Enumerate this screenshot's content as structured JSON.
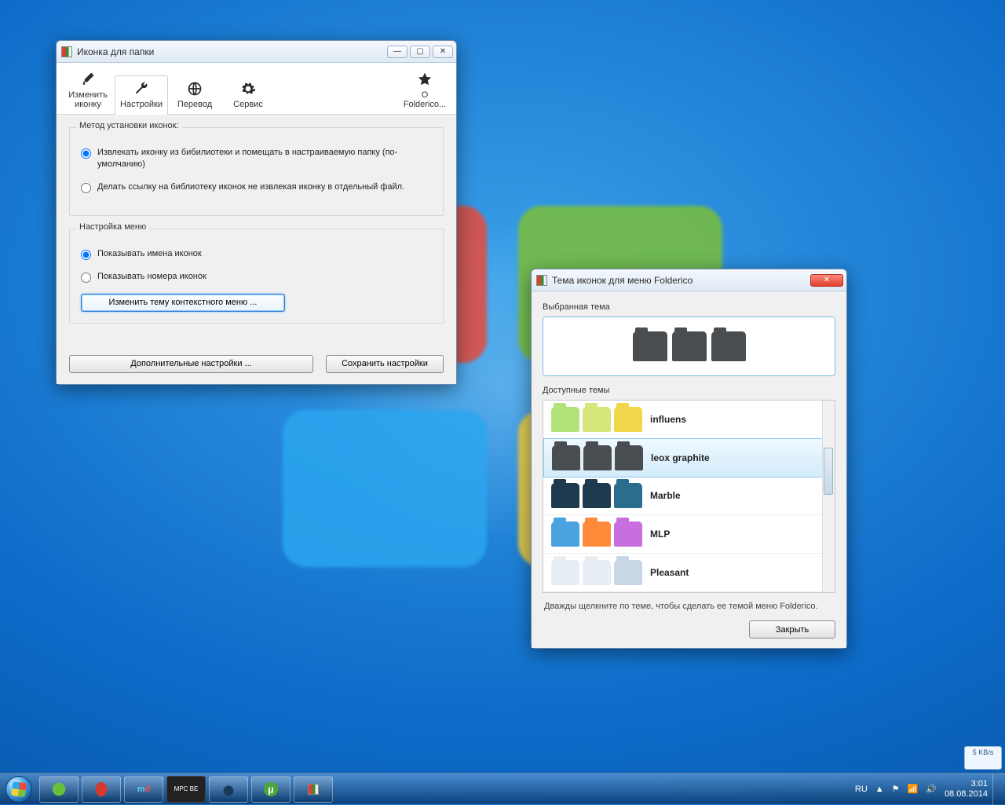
{
  "win1": {
    "title": "Иконка для папки",
    "tabs": {
      "change_icon": "Изменить иконку",
      "settings": "Настройки",
      "translate": "Перевод",
      "service": "Сервис",
      "about": "О Folderico..."
    },
    "group1": {
      "legend": "Метод установки иконок:",
      "opt1": "Извлекать иконку из бибилиотеки и помещать в настраиваемую папку (по-умолчанию)",
      "opt2": "Делать ссылку на библиотеку иконок не извлекая иконку в отдельный файл."
    },
    "group2": {
      "legend": "Настройка меню",
      "opt1": "Показывать имена иконок",
      "opt2": "Показывать номера иконок",
      "btn": "Изменить тему контекстного меню ..."
    },
    "footer": {
      "advanced": "Дополнительные настройки ...",
      "save": "Сохранить настройки"
    }
  },
  "win2": {
    "title": "Тема иконок для меню Folderico",
    "selected_label": "Выбранная тема",
    "available_label": "Доступные темы",
    "themes": [
      {
        "name": "influens",
        "colors": [
          "#b4e27a",
          "#d7e67a",
          "#f2d64a"
        ]
      },
      {
        "name": "leox graphite",
        "colors": [
          "#4a4d50",
          "#4a4d50",
          "#4a4d50"
        ],
        "selected": true
      },
      {
        "name": "Marble",
        "colors": [
          "#1d3a4e",
          "#1d3a4e",
          "#2a6d8e"
        ]
      },
      {
        "name": "MLP",
        "colors": [
          "#4aa3e0",
          "#ff8a3a",
          "#c86fe0"
        ]
      },
      {
        "name": "Pleasant",
        "colors": [
          "#e8eef5",
          "#e8eef5",
          "#c8d6e6"
        ]
      }
    ],
    "hint": "Дважды щелкните по теме, чтобы сделать ее темой меню Folderico.",
    "close": "Закрыть"
  },
  "taskbar_items": [
    "icq",
    "opera",
    "md",
    "mpc",
    "mb",
    "utorrent",
    "folderico"
  ],
  "tray": {
    "lang": "RU",
    "net": "5 KB/s",
    "time": "3:01",
    "date": "08.08.2014"
  }
}
